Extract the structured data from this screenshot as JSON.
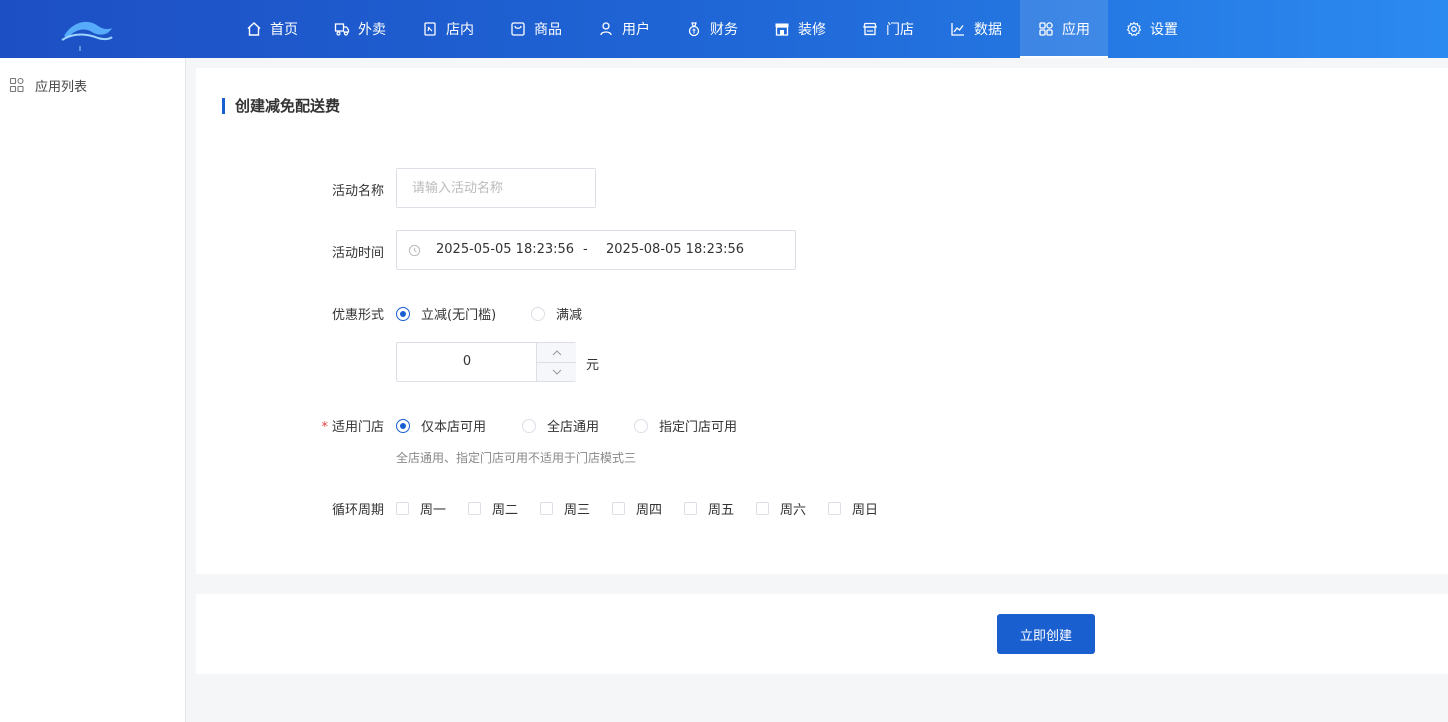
{
  "nav": [
    {
      "label": "首页",
      "icon": "home-icon"
    },
    {
      "label": "外卖",
      "icon": "delivery-icon"
    },
    {
      "label": "店内",
      "icon": "dine-in-icon"
    },
    {
      "label": "商品",
      "icon": "product-icon"
    },
    {
      "label": "用户",
      "icon": "user-icon"
    },
    {
      "label": "财务",
      "icon": "money-bag-icon"
    },
    {
      "label": "装修",
      "icon": "storefront-icon"
    },
    {
      "label": "门店",
      "icon": "store-icon"
    },
    {
      "label": "数据",
      "icon": "chart-icon"
    },
    {
      "label": "应用",
      "icon": "apps-icon",
      "active": true
    },
    {
      "label": "设置",
      "icon": "gear-icon"
    }
  ],
  "sidebar": {
    "items": [
      {
        "label": "应用列表",
        "icon": "apps-icon"
      }
    ]
  },
  "form": {
    "title": "创建减免配送费",
    "name": {
      "label": "活动名称",
      "placeholder": "请输入活动名称",
      "value": ""
    },
    "time": {
      "label": "活动时间",
      "start": "2025-05-05 18:23:56",
      "separator": "-",
      "end": "2025-08-05 18:23:56"
    },
    "discount": {
      "label": "优惠形式",
      "options": [
        "立减(无门槛)",
        "满减"
      ],
      "selected": 0,
      "amount": "0",
      "unit": "元"
    },
    "store": {
      "label": "适用门店",
      "required_mark": "*",
      "options": [
        "仅本店可用",
        "全店通用",
        "指定门店可用"
      ],
      "selected": 0,
      "hint": "全店通用、指定门店可用不适用于门店模式三"
    },
    "cycle": {
      "label": "循环周期",
      "days": [
        "周一",
        "周二",
        "周三",
        "周四",
        "周五",
        "周六",
        "周日"
      ]
    }
  },
  "submit": {
    "label": "立即创建"
  },
  "colors": {
    "primary": "#1a5fd0",
    "header_start": "#1d4fc4",
    "header_end": "#2b8af0"
  }
}
